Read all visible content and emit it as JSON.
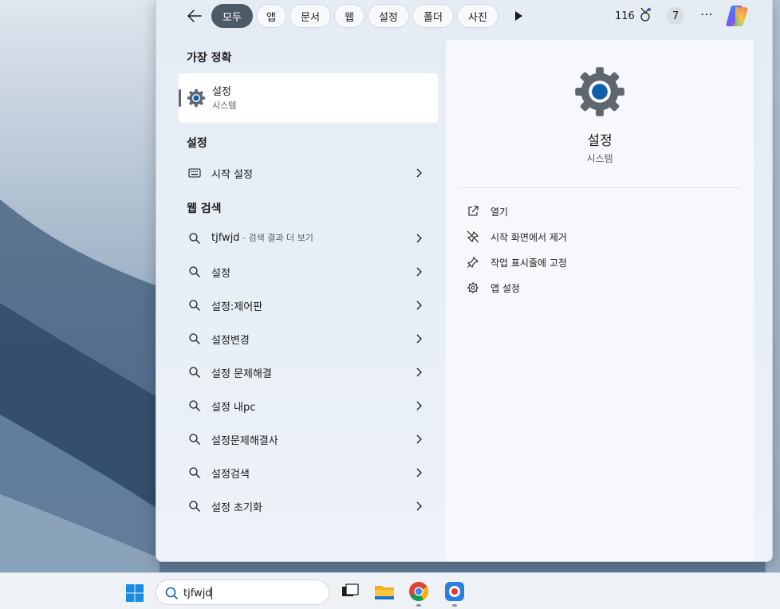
{
  "filter_bar": {
    "chips": [
      "모두",
      "앱",
      "문서",
      "웹",
      "설정",
      "폴더",
      "사진"
    ],
    "active_chip": "모두",
    "points": "116",
    "badge": "7"
  },
  "left": {
    "best_match_title": "가장 정확",
    "best_match": {
      "name": "설정",
      "subtitle": "시스템"
    },
    "settings_title": "설정",
    "settings_items": [
      {
        "label": "시작 설정"
      }
    ],
    "web_title": "웹 검색",
    "web_items": [
      {
        "label": "tjfwjd",
        "suffix": " - 검색 결과 더 보기"
      },
      {
        "label": "설정",
        "suffix": ""
      },
      {
        "label": "설정:제어판",
        "suffix": ""
      },
      {
        "label": "설정변경",
        "suffix": ""
      },
      {
        "label": "설정 문제해결",
        "suffix": ""
      },
      {
        "label": "설정 내pc",
        "suffix": ""
      },
      {
        "label": "설정문제해결사",
        "suffix": ""
      },
      {
        "label": "설정검색",
        "suffix": ""
      },
      {
        "label": "설정 초기화",
        "suffix": ""
      }
    ]
  },
  "preview": {
    "title": "설정",
    "subtitle": "시스템",
    "actions": [
      {
        "label": "열기",
        "icon": "open-external-icon"
      },
      {
        "label": "시작 화면에서 제거",
        "icon": "unpin-icon"
      },
      {
        "label": "작업 표시줄에 고정",
        "icon": "pin-icon"
      },
      {
        "label": "앱 설정",
        "icon": "gear-icon"
      }
    ]
  },
  "taskbar": {
    "search_value": "tjfwjd",
    "apps": [
      "task-view-icon",
      "file-explorer-icon",
      "chrome-icon",
      "screen-recorder-icon"
    ]
  },
  "colors": {
    "accent": "#0f5ea8",
    "active_chip": "#4d5a68",
    "gear": "#5e6670"
  }
}
